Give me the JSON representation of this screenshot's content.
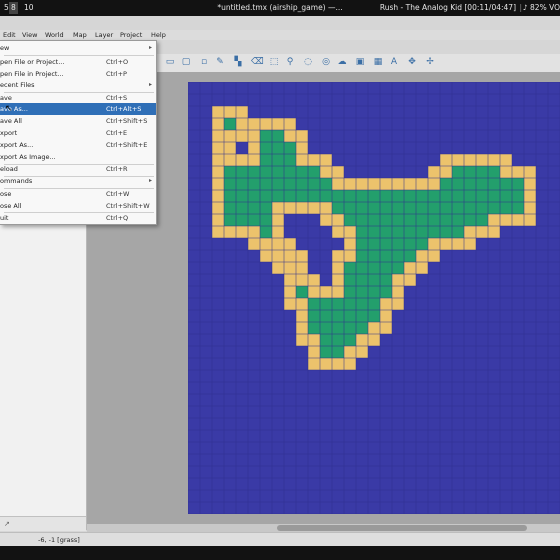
{
  "panel": {
    "workspaces": [
      "5",
      "8",
      "10"
    ],
    "active_workspace": "8",
    "window_title": "*untitled.tmx (airship_game) —...",
    "now_playing": "Rush - The Analog Kid [00:11/04:47]",
    "volume": "82%",
    "volume_suffix": "VO"
  },
  "menubar": {
    "items": [
      "Edit",
      "View",
      "World",
      "Map",
      "Layer",
      "Project",
      "Help"
    ]
  },
  "file_menu": {
    "items": [
      {
        "label": "ew",
        "shortcut": "",
        "submenu": true
      },
      {
        "label": "pen File or Project...",
        "shortcut": "Ctrl+O"
      },
      {
        "label": "pen File in Project...",
        "shortcut": "Ctrl+P"
      },
      {
        "label": "ecent Files",
        "shortcut": "",
        "submenu": true
      },
      {
        "label": "ave",
        "shortcut": "Ctrl+S"
      },
      {
        "label": "ave As...",
        "shortcut": "Ctrl+Alt+S",
        "highlighted": true
      },
      {
        "label": "ave All",
        "shortcut": "Ctrl+Shift+S"
      },
      {
        "label": "xport",
        "shortcut": "Ctrl+E"
      },
      {
        "label": "xport As...",
        "shortcut": "Ctrl+Shift+E"
      },
      {
        "label": "xport As Image...",
        "shortcut": ""
      },
      {
        "label": "eload",
        "shortcut": "Ctrl+R"
      },
      {
        "label": "ommands",
        "shortcut": "",
        "submenu": true
      },
      {
        "label": "ose",
        "shortcut": "Ctrl+W"
      },
      {
        "label": "ose All",
        "shortcut": "Ctrl+Shift+W"
      },
      {
        "label": "uit",
        "shortcut": "Ctrl+Q"
      }
    ]
  },
  "toolbar": {
    "icons": [
      "stamp-brush-icon",
      "terrain-brush-icon",
      "wang-brush-icon",
      "bucket-fill-icon",
      "shape-fill-icon",
      "eraser-icon",
      "rect-select-icon",
      "magic-wand-icon",
      "select-same-icon",
      "select-objects-icon",
      "edit-polygons-icon",
      "insert-rect-icon",
      "insert-point-icon",
      "insert-ellipse-icon",
      "insert-polygon-icon",
      "insert-tile-icon",
      "insert-template-icon",
      "insert-text-icon",
      "world-tool-icon",
      "random-mode-icon"
    ]
  },
  "dock": {
    "bottom_glyph": "↗"
  },
  "statusbar": {
    "coords": "-6, -1 [grass]"
  },
  "map": {
    "colors": {
      "water": "#3a3aa6",
      "sand": "#ecc36c",
      "grass": "#239f6c",
      "grid": "#2e2e8e"
    }
  }
}
